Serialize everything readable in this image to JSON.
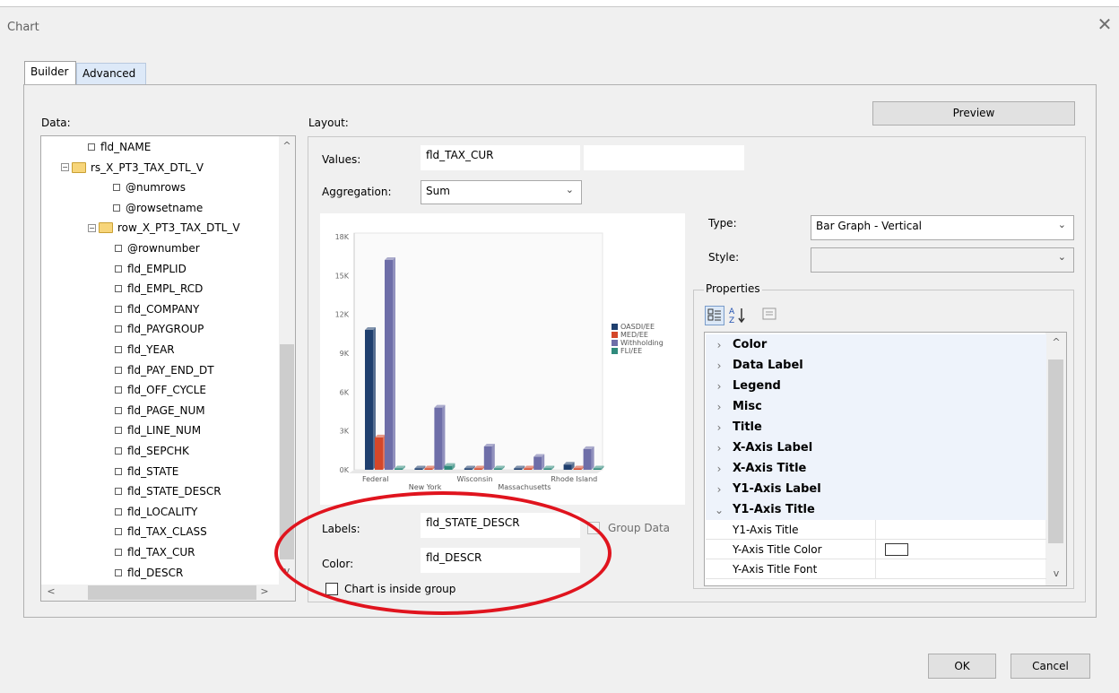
{
  "window": {
    "title": "Chart",
    "close_glyph": "✕"
  },
  "tabs": [
    {
      "label": "Builder",
      "active": true
    },
    {
      "label": "Advanced",
      "active": false
    }
  ],
  "data_section": {
    "label": "Data:",
    "tree": [
      {
        "label": "fld_NAME",
        "kind": "leaf",
        "level": 1
      },
      {
        "label": "rs_X_PT3_TAX_DTL_V",
        "kind": "folder",
        "level": 0
      },
      {
        "label": "@numrows",
        "kind": "leaf",
        "level": 1
      },
      {
        "label": "@rowsetname",
        "kind": "leaf",
        "level": 1
      },
      {
        "label": "row_X_PT3_TAX_DTL_V",
        "kind": "folder",
        "level": 1
      },
      {
        "label": "@rownumber",
        "kind": "leaf",
        "level": 2
      },
      {
        "label": "fld_EMPLID",
        "kind": "leaf",
        "level": 2
      },
      {
        "label": "fld_EMPL_RCD",
        "kind": "leaf",
        "level": 2
      },
      {
        "label": "fld_COMPANY",
        "kind": "leaf",
        "level": 2
      },
      {
        "label": "fld_PAYGROUP",
        "kind": "leaf",
        "level": 2
      },
      {
        "label": "fld_YEAR",
        "kind": "leaf",
        "level": 2
      },
      {
        "label": "fld_PAY_END_DT",
        "kind": "leaf",
        "level": 2
      },
      {
        "label": "fld_OFF_CYCLE",
        "kind": "leaf",
        "level": 2
      },
      {
        "label": "fld_PAGE_NUM",
        "kind": "leaf",
        "level": 2
      },
      {
        "label": "fld_LINE_NUM",
        "kind": "leaf",
        "level": 2
      },
      {
        "label": "fld_SEPCHK",
        "kind": "leaf",
        "level": 2
      },
      {
        "label": "fld_STATE",
        "kind": "leaf",
        "level": 2
      },
      {
        "label": "fld_STATE_DESCR",
        "kind": "leaf",
        "level": 2
      },
      {
        "label": "fld_LOCALITY",
        "kind": "leaf",
        "level": 2
      },
      {
        "label": "fld_TAX_CLASS",
        "kind": "leaf",
        "level": 2
      },
      {
        "label": "fld_TAX_CUR",
        "kind": "leaf",
        "level": 2
      },
      {
        "label": "fld_DESCR",
        "kind": "leaf",
        "level": 2
      }
    ]
  },
  "layout_section": {
    "label": "Layout:",
    "preview_button": "Preview",
    "values_label": "Values:",
    "values_field": "fld_TAX_CUR",
    "aggregation_label": "Aggregation:",
    "aggregation_value": "Sum",
    "type_label": "Type:",
    "type_value": "Bar Graph - Vertical",
    "style_label": "Style:",
    "style_value": "",
    "labels_label": "Labels:",
    "labels_field": "fld_STATE_DESCR",
    "group_data_label": "Group Data",
    "color_label": "Color:",
    "color_field": "fld_DESCR",
    "inside_group_label": "Chart is inside group"
  },
  "properties": {
    "label": "Properties",
    "categories": [
      "Color",
      "Data Label",
      "Legend",
      "Misc",
      "Title",
      "X-Axis Label",
      "X-Axis Title",
      "Y1-Axis Label",
      "Y1-Axis Title"
    ],
    "expanded_items": [
      "Y1-Axis Title",
      "Y-Axis Title Color",
      "Y-Axis Title Font"
    ]
  },
  "footer": {
    "ok": "OK",
    "cancel": "Cancel"
  },
  "colors": {
    "oasdi": "#1f3f6e",
    "med": "#d4472a",
    "withholding": "#6e6ea8",
    "fli": "#2f8a7c",
    "annotation": "#e0141e"
  },
  "chart_data": {
    "type": "bar",
    "categories": [
      "Federal",
      "New York",
      "Wisconsin",
      "Massachusetts",
      "Rhode Island"
    ],
    "series": [
      {
        "name": "OASDI/EE",
        "values": [
          10800,
          0,
          0,
          0,
          400
        ]
      },
      {
        "name": "MED/EE",
        "values": [
          2500,
          0,
          0,
          0,
          100
        ]
      },
      {
        "name": "Withholding",
        "values": [
          16200,
          4800,
          1800,
          1000,
          1600
        ]
      },
      {
        "name": "FLI/EE",
        "values": [
          0,
          300,
          0,
          0,
          0
        ]
      }
    ],
    "yticks": [
      "0K",
      "3K",
      "6K",
      "9K",
      "12K",
      "15K",
      "18K"
    ],
    "ylim": [
      0,
      18000
    ],
    "legend": "right",
    "grid": false
  }
}
